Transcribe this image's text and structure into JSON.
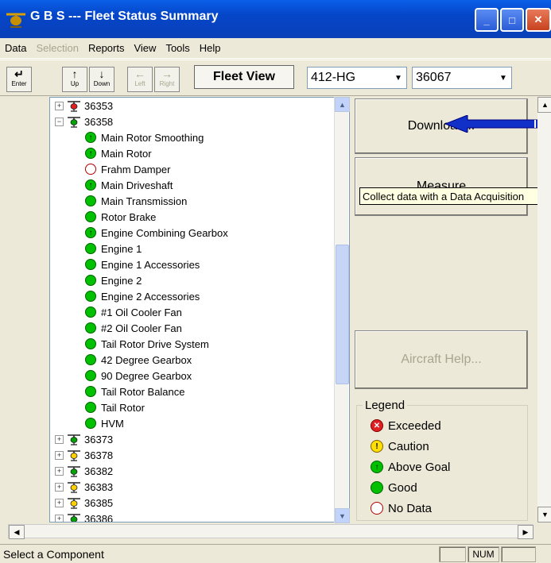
{
  "window": {
    "title": "G B S --- Fleet Status Summary",
    "minimize": "_",
    "maximize": "□",
    "close": "✕"
  },
  "menu": [
    {
      "label": "Data",
      "enabled": true
    },
    {
      "label": "Selection",
      "enabled": false
    },
    {
      "label": "Reports",
      "enabled": true
    },
    {
      "label": "View",
      "enabled": true
    },
    {
      "label": "Tools",
      "enabled": true
    },
    {
      "label": "Help",
      "enabled": true
    }
  ],
  "toolbar": {
    "enter": "Enter",
    "up": "Up",
    "down": "Down",
    "left": "Left",
    "right": "Right",
    "fleet_view": "Fleet View",
    "model_value": "412-HG",
    "tail_value": "36067",
    "dd": "▼"
  },
  "tree": {
    "aircraft_top": [
      {
        "id": "36353",
        "status": "exceeded",
        "expanded": false
      },
      {
        "id": "36358",
        "status": "above",
        "expanded": true
      }
    ],
    "components": [
      {
        "name": "Main Rotor Smoothing",
        "status": "above"
      },
      {
        "name": "Main Rotor",
        "status": "above"
      },
      {
        "name": "Frahm Damper",
        "status": "nodata"
      },
      {
        "name": "Main Driveshaft",
        "status": "above"
      },
      {
        "name": "Main Transmission",
        "status": "good"
      },
      {
        "name": "Rotor Brake",
        "status": "good"
      },
      {
        "name": "Engine Combining Gearbox",
        "status": "above"
      },
      {
        "name": "Engine 1",
        "status": "good"
      },
      {
        "name": "Engine 1 Accessories",
        "status": "good"
      },
      {
        "name": "Engine 2",
        "status": "good"
      },
      {
        "name": "Engine 2 Accessories",
        "status": "good"
      },
      {
        "name": "#1 Oil Cooler Fan",
        "status": "good"
      },
      {
        "name": "#2 Oil Cooler Fan",
        "status": "good"
      },
      {
        "name": "Tail Rotor Drive System",
        "status": "good"
      },
      {
        "name": "42 Degree Gearbox",
        "status": "good"
      },
      {
        "name": "90 Degree Gearbox",
        "status": "good"
      },
      {
        "name": "Tail Rotor Balance",
        "status": "good"
      },
      {
        "name": "Tail Rotor",
        "status": "good"
      },
      {
        "name": "HVM",
        "status": "good"
      }
    ],
    "aircraft_bottom": [
      {
        "id": "36373",
        "status": "above"
      },
      {
        "id": "36378",
        "status": "caution"
      },
      {
        "id": "36382",
        "status": "above"
      },
      {
        "id": "36383",
        "status": "caution"
      },
      {
        "id": "36385",
        "status": "caution"
      },
      {
        "id": "36386",
        "status": "above"
      }
    ]
  },
  "panel": {
    "download": "Download...",
    "measure": "Measure",
    "tooltip": "Collect data with a Data Acquisition",
    "aircraft_help": "Aircraft Help..."
  },
  "legend": {
    "title": "Legend",
    "items": [
      {
        "label": "Exceeded",
        "status": "exceeded",
        "glyph": "✕"
      },
      {
        "label": "Caution",
        "status": "caution",
        "glyph": "!"
      },
      {
        "label": "Above Goal",
        "status": "above",
        "glyph": "↑"
      },
      {
        "label": "Good",
        "status": "good",
        "glyph": ""
      },
      {
        "label": "No Data",
        "status": "nodata",
        "glyph": ""
      }
    ]
  },
  "status": {
    "text": "Select a Component",
    "num": "NUM"
  },
  "colors": {
    "exceeded": "#E02020",
    "caution": "#FFE000",
    "above": "#00C000",
    "good": "#00C000",
    "nodata": "#FFFFFF",
    "title_bar": "#0546C8"
  }
}
